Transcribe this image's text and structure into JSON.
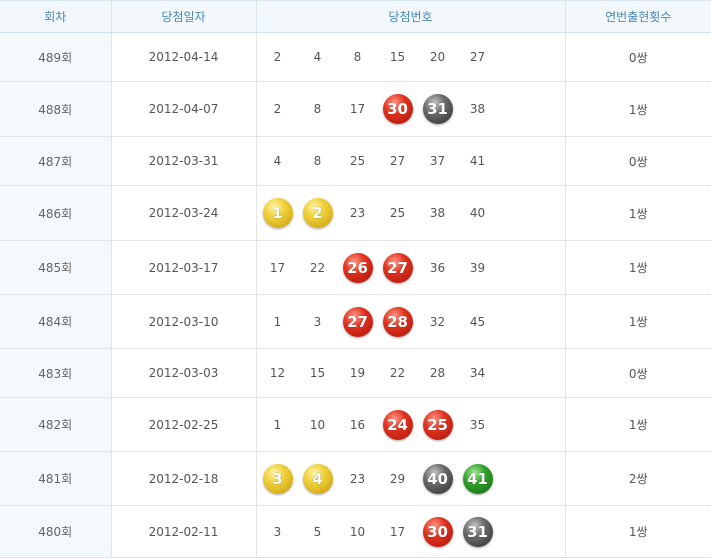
{
  "headers": [
    "회차",
    "당첨일자",
    "당첨번호",
    "연번출현횟수"
  ],
  "ball_colors": {
    "yellow": "#f0d13c",
    "red": "#e2321f",
    "gray": "#6a6a6a",
    "green": "#32a32a"
  },
  "rows": [
    {
      "round": "489회",
      "date": "2012-04-14",
      "count": "0쌍",
      "numbers": [
        {
          "v": "2"
        },
        {
          "v": "4"
        },
        {
          "v": "8"
        },
        {
          "v": "15"
        },
        {
          "v": "20"
        },
        {
          "v": "27"
        }
      ]
    },
    {
      "round": "488회",
      "date": "2012-04-07",
      "count": "1쌍",
      "numbers": [
        {
          "v": "2"
        },
        {
          "v": "8"
        },
        {
          "v": "17"
        },
        {
          "v": "30",
          "ball": "red"
        },
        {
          "v": "31",
          "ball": "gray"
        },
        {
          "v": "38"
        }
      ]
    },
    {
      "round": "487회",
      "date": "2012-03-31",
      "count": "0쌍",
      "numbers": [
        {
          "v": "4"
        },
        {
          "v": "8"
        },
        {
          "v": "25"
        },
        {
          "v": "27"
        },
        {
          "v": "37"
        },
        {
          "v": "41"
        }
      ]
    },
    {
      "round": "486회",
      "date": "2012-03-24",
      "count": "1쌍",
      "numbers": [
        {
          "v": "1",
          "ball": "yellow"
        },
        {
          "v": "2",
          "ball": "yellow"
        },
        {
          "v": "23"
        },
        {
          "v": "25"
        },
        {
          "v": "38"
        },
        {
          "v": "40"
        }
      ]
    },
    {
      "round": "485회",
      "date": "2012-03-17",
      "count": "1쌍",
      "numbers": [
        {
          "v": "17"
        },
        {
          "v": "22"
        },
        {
          "v": "26",
          "ball": "red"
        },
        {
          "v": "27",
          "ball": "red"
        },
        {
          "v": "36"
        },
        {
          "v": "39"
        }
      ]
    },
    {
      "round": "484회",
      "date": "2012-03-10",
      "count": "1쌍",
      "numbers": [
        {
          "v": "1"
        },
        {
          "v": "3"
        },
        {
          "v": "27",
          "ball": "red"
        },
        {
          "v": "28",
          "ball": "red"
        },
        {
          "v": "32"
        },
        {
          "v": "45"
        }
      ]
    },
    {
      "round": "483회",
      "date": "2012-03-03",
      "count": "0쌍",
      "numbers": [
        {
          "v": "12"
        },
        {
          "v": "15"
        },
        {
          "v": "19"
        },
        {
          "v": "22"
        },
        {
          "v": "28"
        },
        {
          "v": "34"
        }
      ]
    },
    {
      "round": "482회",
      "date": "2012-02-25",
      "count": "1쌍",
      "numbers": [
        {
          "v": "1"
        },
        {
          "v": "10"
        },
        {
          "v": "16"
        },
        {
          "v": "24",
          "ball": "red"
        },
        {
          "v": "25",
          "ball": "red"
        },
        {
          "v": "35"
        }
      ]
    },
    {
      "round": "481회",
      "date": "2012-02-18",
      "count": "2쌍",
      "numbers": [
        {
          "v": "3",
          "ball": "yellow"
        },
        {
          "v": "4",
          "ball": "yellow"
        },
        {
          "v": "23"
        },
        {
          "v": "29"
        },
        {
          "v": "40",
          "ball": "gray"
        },
        {
          "v": "41",
          "ball": "green"
        }
      ]
    },
    {
      "round": "480회",
      "date": "2012-02-11",
      "count": "1쌍",
      "numbers": [
        {
          "v": "3"
        },
        {
          "v": "5"
        },
        {
          "v": "10"
        },
        {
          "v": "17"
        },
        {
          "v": "30",
          "ball": "red"
        },
        {
          "v": "31",
          "ball": "gray"
        }
      ]
    }
  ]
}
